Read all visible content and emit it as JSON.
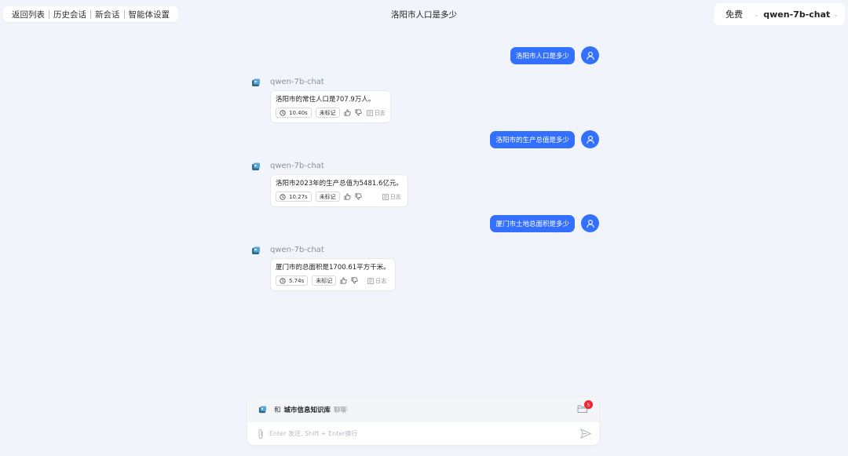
{
  "nav": {
    "back": "返回列表",
    "history": "历史会话",
    "new_session": "新会话",
    "agent_settings": "智能体设置"
  },
  "title": "洛阳市人口是多少",
  "model_selector": {
    "tier": "免费",
    "model": "qwen-7b-chat"
  },
  "messages": [
    {
      "role": "user",
      "text": "洛阳市人口是多少"
    },
    {
      "role": "bot",
      "name": "qwen-7b-chat",
      "text": "洛阳市的常住人口是707.9万人。",
      "time": "10.40s",
      "tag": "未标记",
      "log": "日志"
    },
    {
      "role": "user",
      "text": "洛阳市的生产总值是多少"
    },
    {
      "role": "bot",
      "name": "qwen-7b-chat",
      "text": "洛阳市2023年的生产总值为5481.6亿元。",
      "time": "10.27s",
      "tag": "未标记",
      "log": "日志"
    },
    {
      "role": "user",
      "text": "厦门市土地总面积是多少"
    },
    {
      "role": "bot",
      "name": "qwen-7b-chat",
      "text": "厦门市的总面积是1700.61平方千米。",
      "time": "5.74s",
      "tag": "未标记",
      "log": "日志"
    }
  ],
  "knowledge": {
    "prefix": "和",
    "name": "城市信息知识库",
    "suffix": "聊聊",
    "badge": "5"
  },
  "input": {
    "placeholder": "Enter 发送, Shift + Enter换行",
    "value": ""
  },
  "colors": {
    "accent": "#3370ff",
    "badge": "#f5222d",
    "background": "#f1f4fa"
  }
}
